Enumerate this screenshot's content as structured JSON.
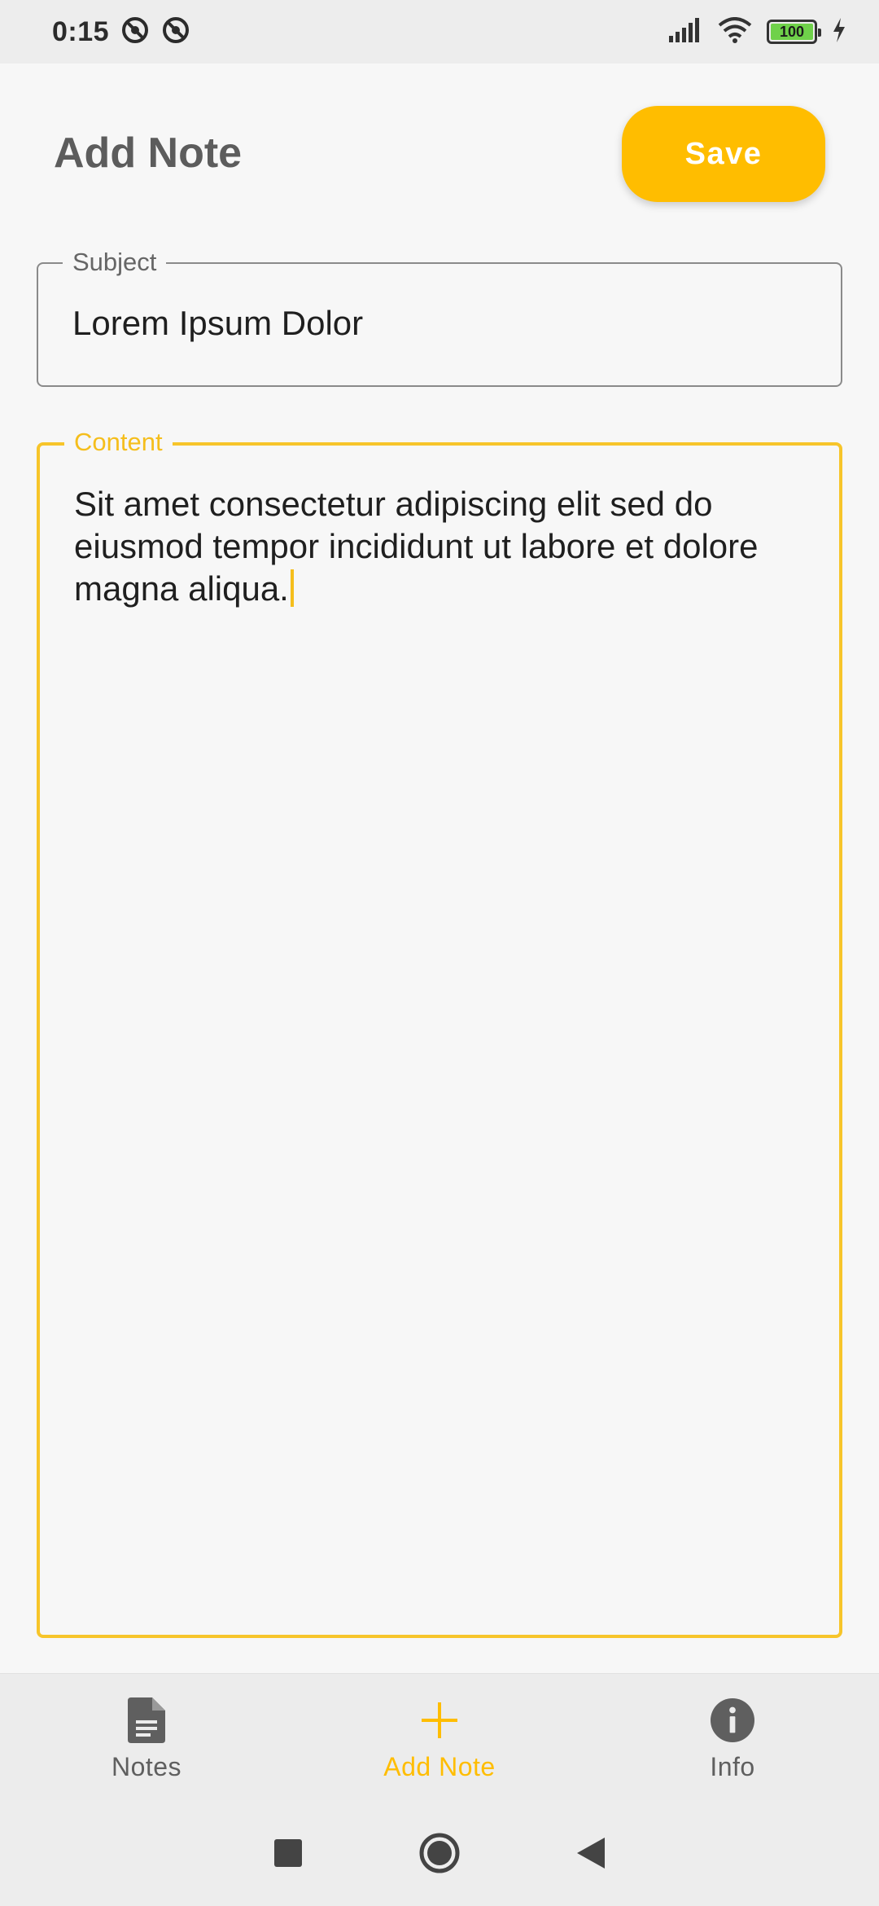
{
  "status_bar": {
    "time": "0:15",
    "battery_level": "100",
    "icons": [
      "notification-icon",
      "notification-icon",
      "signal-icon",
      "wifi-icon",
      "battery-icon",
      "charging-icon"
    ]
  },
  "header": {
    "title": "Add Note",
    "save_label": "Save"
  },
  "form": {
    "subject": {
      "label": "Subject",
      "value": "Lorem Ipsum Dolor"
    },
    "content": {
      "label": "Content",
      "value": "Sit amet consectetur adipiscing elit sed do eiusmod tempor incididunt ut labore et dolore magna aliqua."
    }
  },
  "bottom_nav": {
    "items": [
      {
        "label": "Notes",
        "icon": "document-icon",
        "active": false
      },
      {
        "label": "Add Note",
        "icon": "plus-icon",
        "active": true
      },
      {
        "label": "Info",
        "icon": "info-icon",
        "active": false
      }
    ]
  },
  "system_nav": {
    "buttons": [
      "recents-button",
      "home-button",
      "back-button"
    ]
  },
  "colors": {
    "accent": "#ffbd00",
    "focus_border": "#f7c52a",
    "background": "#f7f7f7",
    "nav_background": "#ececec"
  }
}
